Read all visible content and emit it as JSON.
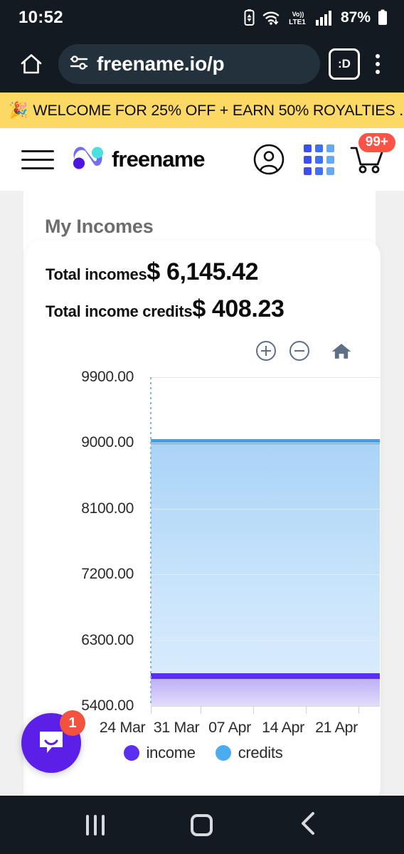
{
  "status_bar": {
    "time": "10:52",
    "battery_percent": "87%",
    "network": "LTE1",
    "volte_label": "Vo)",
    "icons": [
      "battery-saver-icon",
      "wifi-icon",
      "volte-icon",
      "signal-bars-icon",
      "battery-icon"
    ]
  },
  "browser": {
    "home_icon": "home-icon",
    "site_settings_icon": "site-settings-icon",
    "url": "freename.io/p",
    "tab_count_label": ":D",
    "menu_icon": "kebab-menu-icon"
  },
  "promo_banner": {
    "emoji": "🎉",
    "text": "WELCOME FOR 25% OFF + EARN 50% ROYALTIES ...",
    "background": "#fbd964"
  },
  "site_header": {
    "menu_icon": "hamburger-menu-icon",
    "brand_name": "freename",
    "account_icon": "account-circle-icon",
    "apps_icon": "apps-grid-icon",
    "cart_icon": "shopping-cart-icon",
    "cart_badge": "99+",
    "cart_badge_color": "#ff5247"
  },
  "main": {
    "page_title": "My Incomes",
    "stats": [
      {
        "label": "Total incomes",
        "value": "$ 6,145.42"
      },
      {
        "label": "Total income credits",
        "value": "$ 408.23"
      }
    ],
    "chart_controls": [
      {
        "name": "zoom-in-button",
        "glyph": "+"
      },
      {
        "name": "zoom-out-button",
        "glyph": "−"
      },
      {
        "name": "reset-home-button",
        "glyph": "home"
      }
    ]
  },
  "chart_data": {
    "type": "area",
    "title": "",
    "xlabel": "",
    "ylabel": "",
    "grid": true,
    "legend_position": "bottom",
    "x": [
      "24 Mar",
      "31 Mar",
      "07 Apr",
      "14 Apr",
      "21 Apr"
    ],
    "ytick_labels": [
      "9900.00",
      "9000.00",
      "8100.00",
      "7200.00",
      "6300.00",
      "5400.00"
    ],
    "ytick_values": [
      9900,
      9000,
      8100,
      7200,
      6300,
      5400
    ],
    "ylim": [
      5400,
      9900
    ],
    "series": [
      {
        "name": "income",
        "color": "#5b2fef",
        "fill": "#cdc2f8",
        "values": [
          5870,
          5870,
          5870,
          5870,
          5880
        ]
      },
      {
        "name": "credits",
        "color": "#3fa0ee",
        "fill": "#c9e4fb",
        "values": [
          9050,
          9050,
          9050,
          9055,
          9070
        ]
      }
    ],
    "legend": [
      {
        "label": "income",
        "color": "#5b2fef"
      },
      {
        "label": "credits",
        "color": "#4dabf0"
      }
    ]
  },
  "chat_widget": {
    "name": "intercom-launcher",
    "unread_badge": "1",
    "color": "#5b1fe8"
  },
  "nav_bar": {
    "recents_label": "recents-button",
    "home_label": "home-button",
    "back_label": "back-button"
  }
}
